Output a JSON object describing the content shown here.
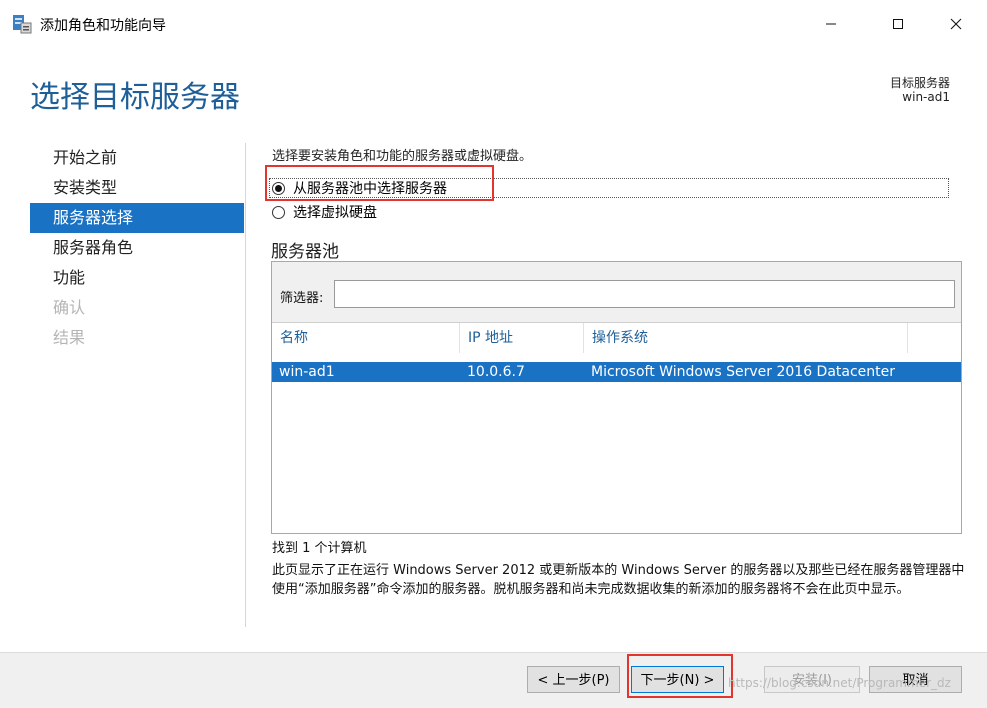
{
  "window": {
    "title": "添加角色和功能向导",
    "controls": [
      "minimize-icon",
      "maximize-icon",
      "close-icon"
    ]
  },
  "header": {
    "page_title": "选择目标服务器",
    "destination_label": "目标服务器",
    "destination_value": "win-ad1"
  },
  "nav": {
    "items": [
      {
        "label": "开始之前",
        "state": "normal"
      },
      {
        "label": "安装类型",
        "state": "normal"
      },
      {
        "label": "服务器选择",
        "state": "active"
      },
      {
        "label": "服务器角色",
        "state": "normal"
      },
      {
        "label": "功能",
        "state": "normal"
      },
      {
        "label": "确认",
        "state": "disabled"
      },
      {
        "label": "结果",
        "state": "disabled"
      }
    ]
  },
  "content": {
    "instruction": "选择要安装角色和功能的服务器或虚拟硬盘。",
    "options": [
      {
        "label": "从服务器池中选择服务器",
        "selected": true
      },
      {
        "label": "选择虚拟硬盘",
        "selected": false
      }
    ],
    "pool": {
      "title": "服务器池",
      "filter_label": "筛选器:",
      "filter_value": "",
      "columns": [
        "名称",
        "IP 地址",
        "操作系统"
      ],
      "rows": [
        {
          "name": "win-ad1",
          "ip": "10.0.6.7",
          "os": "Microsoft Windows Server 2016 Datacenter",
          "selected": true
        }
      ]
    },
    "found_text": "找到 1 个计算机",
    "notice": "此页显示了正在运行 Windows Server 2012 或更新版本的 Windows Server 的服务器以及那些已经在服务器管理器中使用“添加服务器”命令添加的服务器。脱机服务器和尚未完成数据收集的新添加的服务器将不会在此页中显示。"
  },
  "footer": {
    "prev_label": "< 上一步(P)",
    "next_label": "下一步(N) >",
    "install_label": "安装(I)",
    "cancel_label": "取消"
  },
  "watermark": "https://blog.csdn.net/Programmer_dz",
  "colors": {
    "accent": "#1a72c4",
    "title_blue": "#1e5f99",
    "highlight_red": "#e2352e",
    "footer_bg": "#f0f0f0"
  }
}
